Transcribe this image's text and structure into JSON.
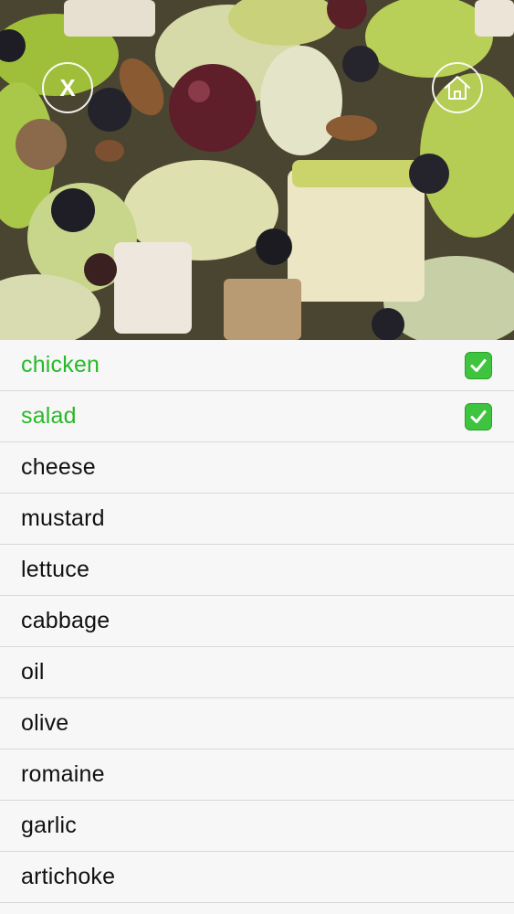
{
  "header": {
    "close_label": "X",
    "close_icon": "close-icon",
    "home_icon": "home-icon"
  },
  "photo": {
    "subject": "salad-photo"
  },
  "list": {
    "items": [
      {
        "label": "chicken",
        "selected": true
      },
      {
        "label": "salad",
        "selected": true
      },
      {
        "label": "cheese",
        "selected": false
      },
      {
        "label": "mustard",
        "selected": false
      },
      {
        "label": "lettuce",
        "selected": false
      },
      {
        "label": "cabbage",
        "selected": false
      },
      {
        "label": "oil",
        "selected": false
      },
      {
        "label": "olive",
        "selected": false
      },
      {
        "label": "romaine",
        "selected": false
      },
      {
        "label": "garlic",
        "selected": false
      },
      {
        "label": "artichoke",
        "selected": false
      }
    ],
    "check_icon": "check-mark-icon",
    "selected_color": "#28b928",
    "check_bg": "#3ec43e"
  }
}
